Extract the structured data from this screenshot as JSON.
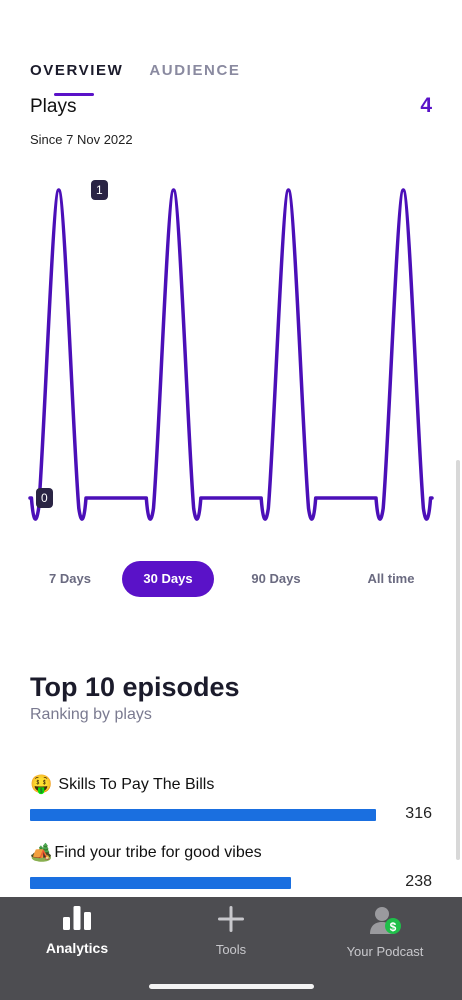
{
  "tabs": [
    {
      "label": "OVERVIEW",
      "active": true
    },
    {
      "label": "AUDIENCE",
      "active": false
    }
  ],
  "plays": {
    "title": "Plays",
    "total": "4",
    "since": "Since 7 Nov 2022"
  },
  "chart_data": {
    "type": "line",
    "ylim": [
      0,
      1
    ],
    "tick_labels": [
      "0",
      "1"
    ],
    "series": [
      {
        "values": [
          0,
          1,
          0,
          0,
          0,
          1,
          0,
          0,
          0,
          1,
          0,
          0,
          0,
          1,
          0
        ]
      }
    ],
    "color": "#4b0fb8"
  },
  "time_ranges": [
    {
      "label": "7 Days",
      "active": false
    },
    {
      "label": "30 Days",
      "active": true
    },
    {
      "label": "90 Days",
      "active": false
    },
    {
      "label": "All time",
      "active": false
    }
  ],
  "top_episodes": {
    "title": "Top 10 episodes",
    "subtitle": "Ranking by plays",
    "max_value": 316,
    "items": [
      {
        "emoji": "🤑",
        "title": "Skills To Pay The Bills",
        "count": "316",
        "value": 316
      },
      {
        "emoji": "🏕️",
        "title": "Find your tribe for good vibes",
        "count": "238",
        "value": 238
      }
    ]
  },
  "nav": [
    {
      "label": "Analytics",
      "icon": "bar-chart-icon",
      "active": true
    },
    {
      "label": "Tools",
      "icon": "plus-icon",
      "active": false
    },
    {
      "label": "Your Podcast",
      "icon": "user-dollar-icon",
      "active": false
    }
  ],
  "colors": {
    "accent": "#5a12c8",
    "bar": "#1a6fe0",
    "nav_bg": "#4d4d51"
  }
}
